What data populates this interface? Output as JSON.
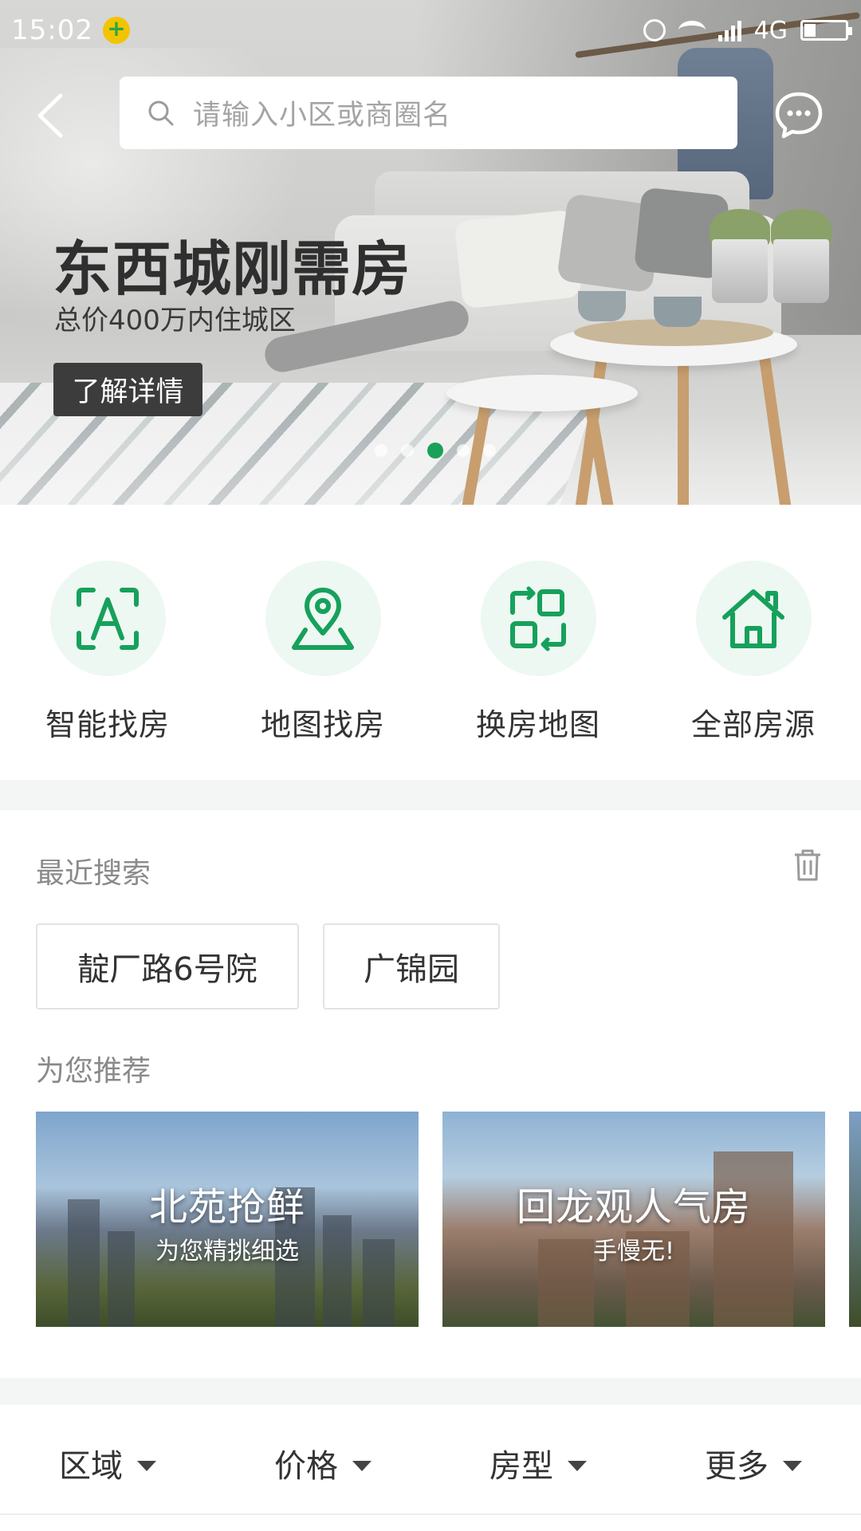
{
  "status_bar": {
    "time": "15:02",
    "network": "4G",
    "colors": {
      "badge": "#f2c400",
      "badge_plus": "#2aa745"
    }
  },
  "header": {
    "search_placeholder": "请输入小区或商圈名",
    "back_icon": "chevron-left-icon",
    "message_icon": "chat-bubble-icon"
  },
  "banner": {
    "title": "东西城刚需房",
    "subtitle": "总价400万内住城区",
    "button_label": "了解详情",
    "carousel": {
      "count": 5,
      "active_index": 2
    }
  },
  "nav": {
    "items": [
      {
        "label": "智能找房",
        "icon": "smart-search-icon"
      },
      {
        "label": "地图找房",
        "icon": "map-pin-icon"
      },
      {
        "label": "换房地图",
        "icon": "swap-grid-icon"
      },
      {
        "label": "全部房源",
        "icon": "house-icon"
      }
    ]
  },
  "recent_search": {
    "title": "最近搜索",
    "clear_icon": "trash-icon",
    "chips": [
      "靛厂路6号院",
      "广锦园"
    ]
  },
  "recommend": {
    "title": "为您推荐",
    "cards": [
      {
        "title": "北苑抢鲜",
        "subtitle": "为您精挑细选"
      },
      {
        "title": "回龙观人气房",
        "subtitle": "手慢无!"
      }
    ]
  },
  "filters": [
    "区域",
    "价格",
    "房型",
    "更多"
  ],
  "colors": {
    "accent": "#19a15a",
    "icon_bg": "#eef8f2",
    "section_gap": "#f4f5f5"
  }
}
